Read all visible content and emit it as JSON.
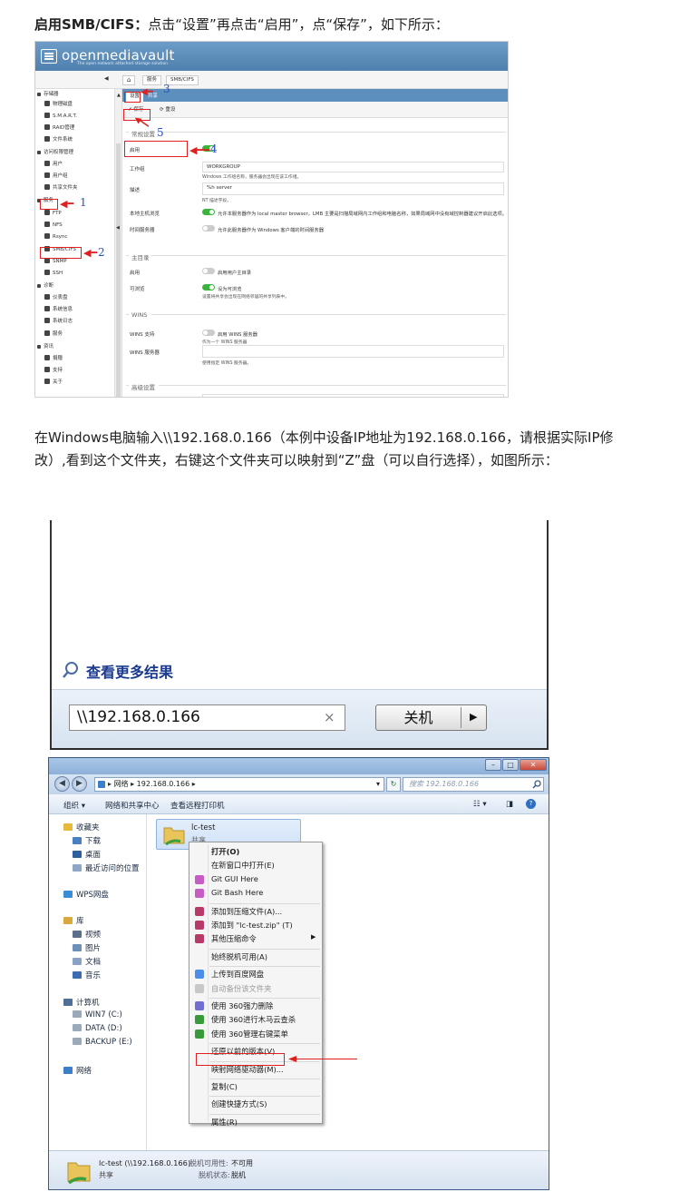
{
  "step1": {
    "bold": "启用SMB/CIFS：",
    "text": "点击“设置”再点击“启用”，点“保存”，如下所示："
  },
  "omv": {
    "title": "openmediavault",
    "subtitle": "The open network attached storage solution",
    "breadcrumb": [
      "服务",
      "SMB/CIFS"
    ],
    "sidebar": [
      {
        "label": "存储器",
        "level": "cat"
      },
      {
        "label": "物理磁盘",
        "level": "sub"
      },
      {
        "label": "S.M.A.R.T.",
        "level": "sub"
      },
      {
        "label": "RAID管理",
        "level": "sub"
      },
      {
        "label": "文件系统",
        "level": "sub"
      },
      {
        "label": "访问权限管理",
        "level": "cat"
      },
      {
        "label": "用户",
        "level": "sub"
      },
      {
        "label": "用户组",
        "level": "sub"
      },
      {
        "label": "共享文件夹",
        "level": "sub"
      },
      {
        "label": "服务",
        "level": "cat"
      },
      {
        "label": "FTP",
        "level": "sub"
      },
      {
        "label": "NFS",
        "level": "sub"
      },
      {
        "label": "Rsync",
        "level": "sub"
      },
      {
        "label": "SMB/CIFS",
        "level": "sub"
      },
      {
        "label": "SNMP",
        "level": "sub"
      },
      {
        "label": "SSH",
        "level": "sub"
      },
      {
        "label": "诊断",
        "level": "cat"
      },
      {
        "label": "仪表盘",
        "level": "sub"
      },
      {
        "label": "系统信息",
        "level": "sub"
      },
      {
        "label": "系统日志",
        "level": "sub"
      },
      {
        "label": "服务",
        "level": "sub"
      },
      {
        "label": "资讯",
        "level": "cat"
      },
      {
        "label": "捐赠",
        "level": "sub"
      },
      {
        "label": "支持",
        "level": "sub"
      },
      {
        "label": "关于",
        "level": "sub"
      }
    ],
    "tabs": [
      "设置",
      "共享"
    ],
    "save": "保存",
    "reset": "重设",
    "general_legend": "常规设置",
    "enable_label": "启用",
    "workgroup_label": "工作组",
    "workgroup_value": "WORKGROUP",
    "workgroup_hint": "Windows 工作组名称，服务器会出现在该工作组。",
    "desc_label": "描述",
    "desc_value": "%h server",
    "desc_hint": "NT 描述字段。",
    "lmb_label": "本地主机浏览",
    "lmb_text": "允许本服务器作为 local master browser，LMB 主要是扫描局域网内工作组和电脑名称，如果局域网中没有域控制器建议开启此选项。",
    "time_label": "时间服务器",
    "time_text": "允许此服务器作为 Windows 客户端的时间服务器",
    "home_legend": "主目录",
    "home_enable_label": "启用",
    "home_enable_text": "启用用户主目录",
    "browsable_label": "可浏览",
    "browsable_text": "设为可浏览",
    "browsable_hint": "设置将共享会出现在网络邻居的共享列表中。",
    "wins_legend": "WINS",
    "wins_support_label": "WINS 支持",
    "wins_support_text": "启用 WINS 服务器",
    "wins_support_hint": "作为一个 WINS 服务器",
    "wins_server_label": "WINS 服务器",
    "wins_server_hint": "使用指定 WINS 服务器。",
    "advanced_legend": "高级设置",
    "annotations": [
      "1",
      "2",
      "3",
      "4",
      "5"
    ]
  },
  "step2": {
    "text": "在Windows电脑输入\\\\192.168.0.166（本例中设备IP地址为192.168.0.166，请根据实际IP修改）,看到这个文件夹，右键这个文件夹可以映射到“Z”盘（可以自行选择），如图所示："
  },
  "run": {
    "more_results": "查看更多结果",
    "input_value": "\\\\192.168.0.166",
    "shutdown_label": "关机",
    "clear_glyph": "×",
    "arrow_glyph": "▶"
  },
  "explorer": {
    "win_buttons": [
      "–",
      "□",
      "✕"
    ],
    "address": [
      "网络",
      "192.168.0.166"
    ],
    "search_placeholder": "搜索 192.168.0.166",
    "commands": [
      "组织 ▾",
      "网络和共享中心",
      "查看远程打印机"
    ],
    "nav": [
      {
        "label": "收藏夹",
        "color": "#e8b83a"
      },
      {
        "label": "下载",
        "color": "#4a7fc1"
      },
      {
        "label": "桌面",
        "color": "#2f5f9e"
      },
      {
        "label": "最近访问的位置",
        "color": "#8fa6c4"
      },
      {
        "label": "WPS网盘",
        "color": "#3a8ed8"
      },
      {
        "label": "库",
        "color": "#d9a93e"
      },
      {
        "label": "视频",
        "color": "#5b6f8c"
      },
      {
        "label": "图片",
        "color": "#6d8fb8"
      },
      {
        "label": "文档",
        "color": "#8aa3c4"
      },
      {
        "label": "音乐",
        "color": "#3c6db3"
      },
      {
        "label": "计算机",
        "color": "#4f6f96"
      },
      {
        "label": "WIN7 (C:)",
        "color": "#9aaabb"
      },
      {
        "label": "DATA (D:)",
        "color": "#9aaabb"
      },
      {
        "label": "BACKUP (E:)",
        "color": "#9aaabb"
      },
      {
        "label": "网络",
        "color": "#3a7fc8"
      }
    ],
    "folder_name": "lc-test",
    "folder_sub": "共享",
    "context_menu": [
      {
        "label": "打开(O)",
        "bold": true
      },
      {
        "label": "在新窗口中打开(E)"
      },
      {
        "label": "Git GUI Here",
        "icon": "#c65cc4"
      },
      {
        "label": "Git Bash Here",
        "icon": "#c65cc4"
      },
      {
        "label": "添加到压缩文件(A)...",
        "icon": "#b73a6a",
        "sep": true
      },
      {
        "label": "添加到 \"lc-test.zip\" (T)",
        "icon": "#b73a6a"
      },
      {
        "label": "其他压缩命令",
        "icon": "#b73a6a",
        "sub": true
      },
      {
        "label": "始终脱机可用(A)",
        "sep": true
      },
      {
        "label": "上传到百度网盘",
        "icon": "#4b8ee8",
        "sep": true
      },
      {
        "label": "自动备份该文件夹",
        "icon": "#c8c8c8",
        "gray": true
      },
      {
        "label": "使用 360强力删除",
        "icon": "#6e6ed4",
        "sep": true
      },
      {
        "label": "使用 360进行木马云查杀",
        "icon": "#3a9a3a"
      },
      {
        "label": "使用 360管理右键菜单",
        "icon": "#3a9a3a"
      },
      {
        "label": "还原以前的版本(V)",
        "sep": true
      },
      {
        "label": "映射网络驱动器(M)...",
        "sep": true,
        "highlight": true
      },
      {
        "label": "复制(C)",
        "sep": true
      },
      {
        "label": "创建快捷方式(S)",
        "sep": true
      },
      {
        "label": "属性(R)",
        "sep": true
      }
    ],
    "status": {
      "name": "lc-test (\\\\192.168.0.166)",
      "offline_label": "脱机可用性:",
      "offline_value": "不可用",
      "type": "共享",
      "state_label": "脱机状态:",
      "state_value": "脱机"
    }
  },
  "colors": {
    "omv_blue": "#5d8fbd",
    "annot_red": "#e02020",
    "annot_blue": "#2a4fc9",
    "toggle_on": "#3cb33c"
  }
}
